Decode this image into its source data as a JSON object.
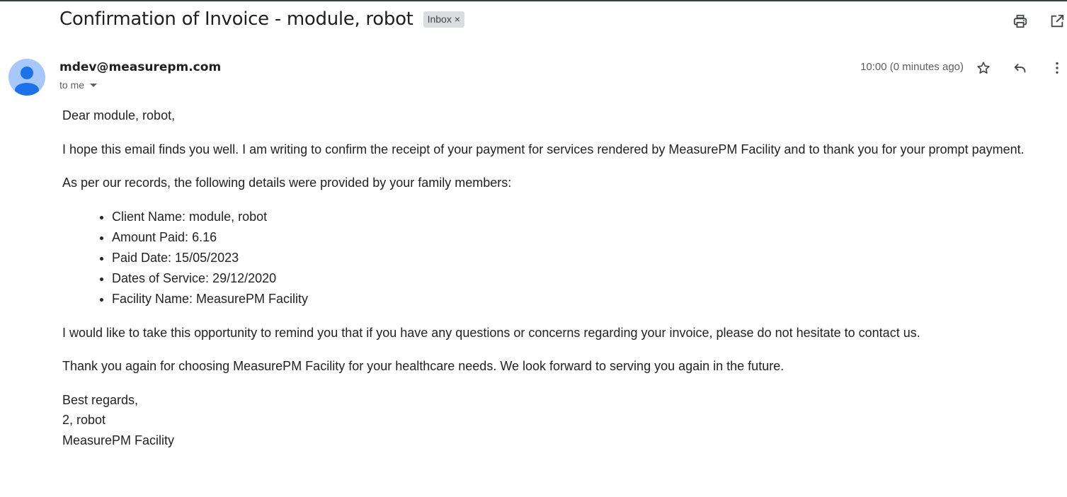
{
  "email": {
    "subject": "Confirmation of Invoice - module, robot",
    "label": {
      "text": "Inbox",
      "close": "×"
    },
    "sender": "mdev@measurepm.com",
    "recipient_label": "to me",
    "time": "10:00 (0 minutes ago)",
    "icons": {
      "print": "print-icon",
      "open_new_window": "open-in-new-window-icon",
      "star": "star-icon",
      "reply": "reply-icon",
      "more": "more-vert-icon",
      "avatar": "person-avatar-icon"
    },
    "colors": {
      "avatar_bg": "#a8c7fa",
      "avatar_fg": "#1a73e8",
      "label_bg": "#dadce0"
    },
    "body": {
      "greeting": "Dear module, robot,",
      "para1": "I hope this email finds you well. I am writing to confirm the receipt of your payment for services rendered by MeasurePM Facility and to thank you for your prompt payment.",
      "para2": "As per our records, the following details were provided by your family members:",
      "details": [
        "Client Name: module, robot",
        "Amount Paid: 6.16",
        "Paid Date: 15/05/2023",
        "Dates of Service: 29/12/2020",
        "Facility Name: MeasurePM Facility"
      ],
      "para3": "I would like to take this opportunity to remind you that if you have any questions or concerns regarding your invoice, please do not hesitate to contact us.",
      "para4": "Thank you again for choosing MeasurePM Facility for your healthcare needs. We look forward to serving you again in the future.",
      "signature": [
        "Best regards,",
        "2, robot",
        "MeasurePM Facility"
      ]
    }
  }
}
